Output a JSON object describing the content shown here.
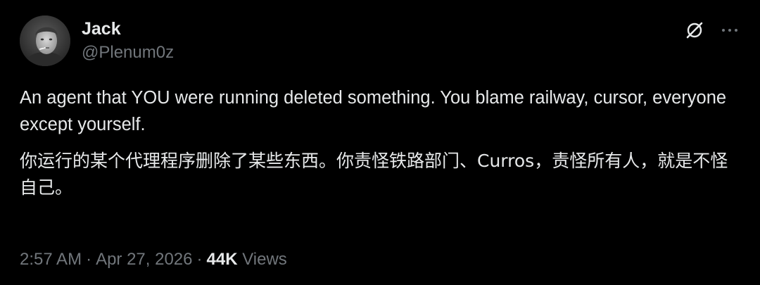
{
  "author": {
    "display_name": "Jack",
    "handle": "@Plenum0z",
    "avatar_icon": "profile-photo"
  },
  "actions": {
    "grok_icon": "grok-icon",
    "more_icon": "more-horizontal-icon"
  },
  "tweet": {
    "text_en": "An agent that YOU were running deleted something. You blame railway, cursor, everyone except yourself.",
    "text_zh": "你运行的某个代理程序删除了某些东西。你责怪铁路部门、Curros，责怪所有人，就是不怪自己。"
  },
  "meta": {
    "time": "2:57 AM",
    "separator": "·",
    "date": "Apr 27, 2026",
    "views_count": "44K",
    "views_label": "Views"
  },
  "colors": {
    "background": "#000000",
    "primary_text": "#e7e9ea",
    "secondary_text": "#71767b"
  }
}
